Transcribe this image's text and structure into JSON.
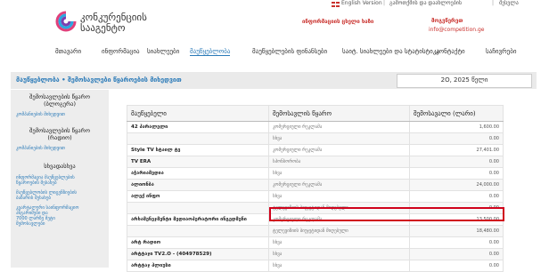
{
  "utility": {
    "language": "English Version",
    "register": "გამოთქმის და დაახლოების",
    "login": "შესვლა"
  },
  "header": {
    "brand_line1": "კონკურენციის",
    "brand_line2": "სააგენტო",
    "hotline": "ინფორმაციის ცხელი ხაზი",
    "contact_label": "მოგვწერეთ",
    "contact_email": "info@competition.ge"
  },
  "nav": {
    "items": [
      "მთავარი",
      "ინფორმაცია",
      "სიახლეები",
      "მაუწყებლობა",
      "მაუწყებლების ფინანსები",
      "საიტ. სიახლეები და სტატისტიკა",
      "კონტაქტი",
      "საჩივრები"
    ],
    "active_index": 3
  },
  "breadcrumb": {
    "text": "მაუწყებლობა • შემოსავლები წყაროების მიხედვით",
    "date": "2O, 2025 წელი"
  },
  "sidebar": {
    "sections": [
      {
        "title_line1": "შემოსავლების წყარო",
        "title_line2": "(ბლოგერა)",
        "link": "კომპანიების მიხედვით"
      },
      {
        "title_line1": "შემოსავლების წყარო",
        "title_line2": "(რადიო)",
        "link": "კომპანიების მიხედვით"
      },
      {
        "title_line1": "სხვადასხვა",
        "title_line2": "",
        "link": ""
      }
    ],
    "links": [
      "ინფორმაცია მაუწყებლების",
      "წყაროების შესახებ",
      "მაუწყებლობის ლიცენზიების",
      "ბაზარის შესახებ",
      "კვარტალური საინფორმაციო",
      "ანგარიშები და",
      "7000 ლარზე მეტი",
      "შემოსავლები"
    ]
  },
  "table": {
    "headers": [
      "მაუწყებელი",
      "შემოსავლის წყარო",
      "შემოსავალი (ლარი)"
    ],
    "rows": [
      {
        "name": "42 პარალელი",
        "source": "კომერციული რეკლამა",
        "amount": "1,600.00"
      },
      {
        "name": "",
        "source": "სხვა",
        "amount": "0.00"
      },
      {
        "name": "Style TV სტაილ ტვ",
        "source": "კომერციული რეკლამა",
        "amount": "27,401.00"
      },
      {
        "name": "TV ERA",
        "source": "სპონსორობა",
        "amount": "0.00"
      },
      {
        "name": "აჭარიამედია",
        "source": "სხვა",
        "amount": "0.00"
      },
      {
        "name": "ალიონბა",
        "source": "კომერციული რეკლამა",
        "amount": "24,000.00"
      },
      {
        "name": "ალექ ინფო",
        "source": "სხვა",
        "amount": "0.00"
      },
      {
        "name": "",
        "source": "ტელევიზიის ბიუჯეტიდან მიღებული",
        "amount": "0.00"
      },
      {
        "name": "არხამენეჯმენტი მედიაოპერატორი ინგედმენი",
        "source": "კომერციული რეკლამა",
        "amount": "13,500.00"
      },
      {
        "name": "",
        "source": "ტელევიზიის ბიუჯეტიდან მიღებული",
        "amount": "18,480.00"
      },
      {
        "name": "არტ რადიო",
        "source": "სხვა",
        "amount": "0.00"
      },
      {
        "name": "არტტაჯი TV2.O - (404978529)",
        "source": "სხვა",
        "amount": "0.00"
      },
      {
        "name": "არტტაჯ პლიუსი",
        "source": "სხვა",
        "amount": "0.00"
      }
    ]
  }
}
